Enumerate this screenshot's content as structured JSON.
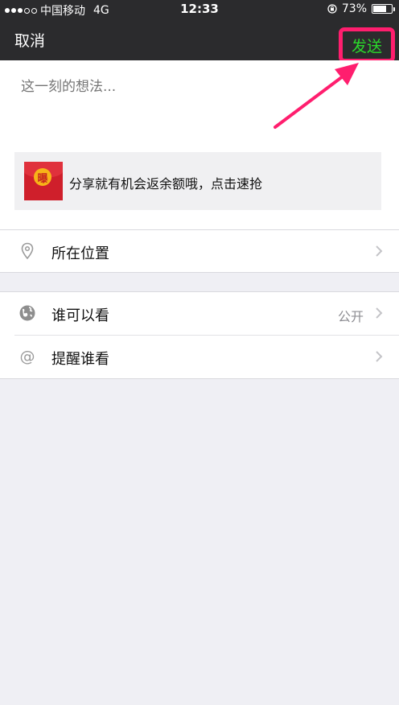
{
  "status_bar": {
    "carrier": "中国移动",
    "network": "4G",
    "time": "12:33",
    "battery": "73%",
    "battery_level": 0.73
  },
  "nav": {
    "cancel_label": "取消",
    "send_label": "发送"
  },
  "compose": {
    "placeholder": "这一刻的想法..."
  },
  "share_card": {
    "icon_glyph": "曝",
    "text": "分享就有机会返余额哦，点击速抢"
  },
  "options": {
    "location": {
      "label": "所在位置"
    },
    "visibility": {
      "label": "谁可以看",
      "value": "公开"
    },
    "remind": {
      "label": "提醒谁看"
    }
  },
  "colors": {
    "navbar_bg": "#2b2b2d",
    "send_green": "#2bd92b",
    "highlight_pink": "#ff1e6e",
    "page_bg": "#efeff4"
  }
}
